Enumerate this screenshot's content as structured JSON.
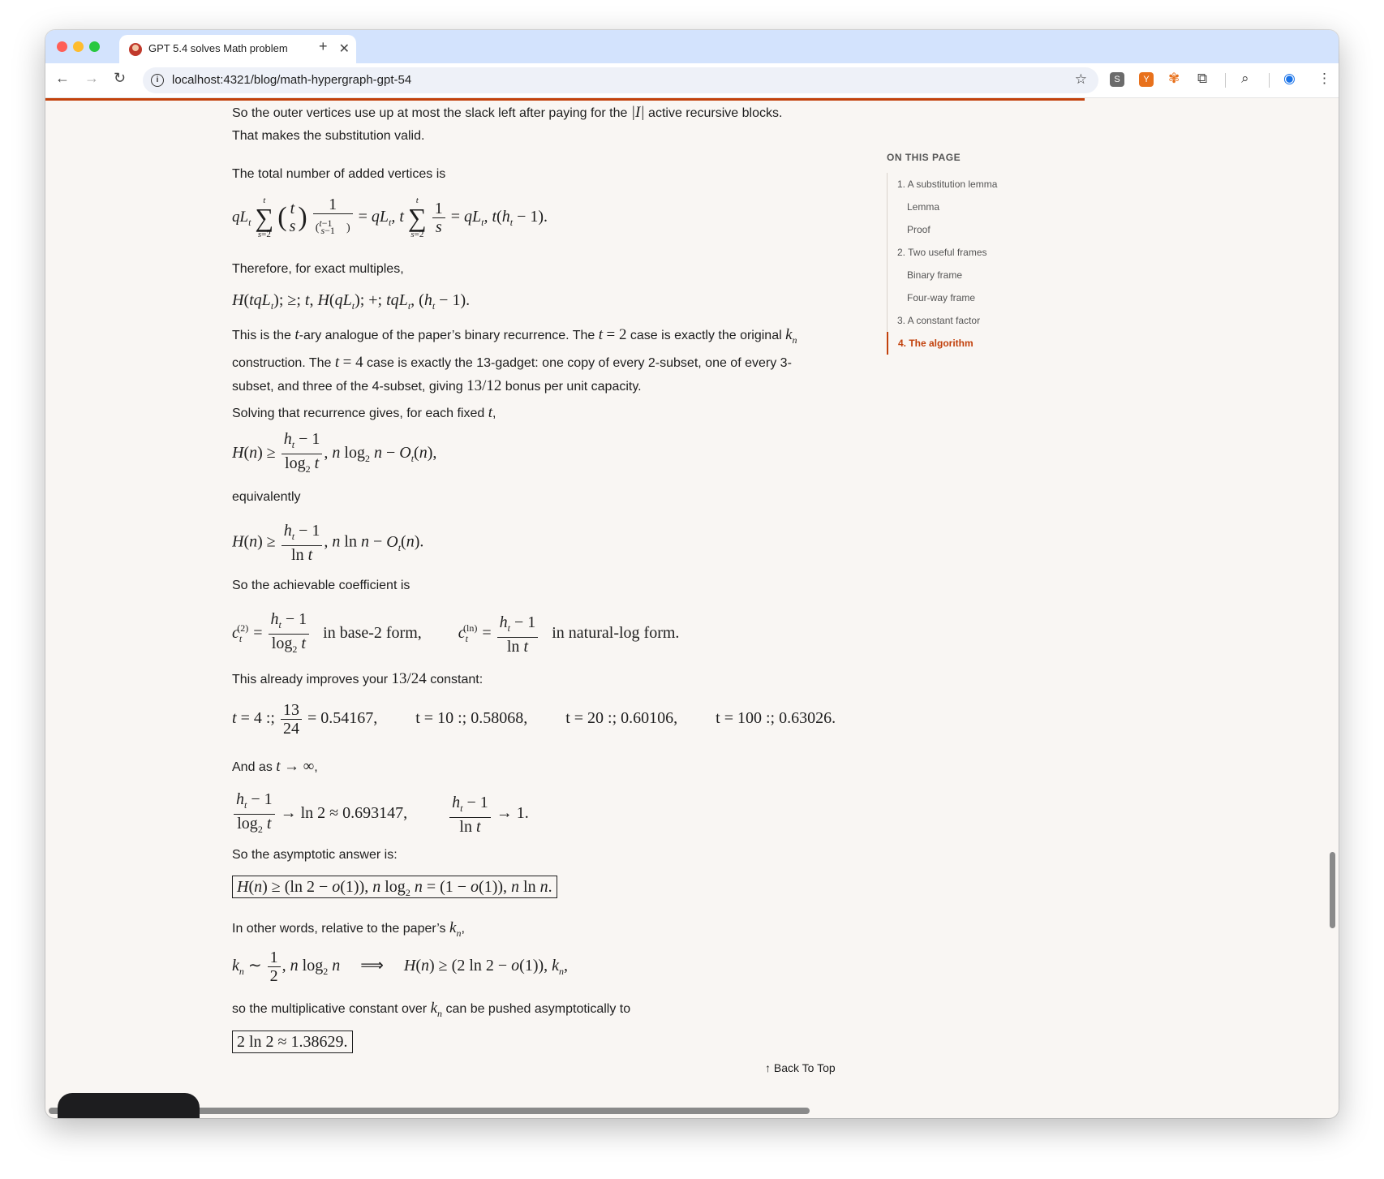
{
  "browser": {
    "tab_title": "GPT 5.4 solves Math problem",
    "tab_close": "✕",
    "new_tab": "+",
    "url": "localhost:4321/blog/math-hypergraph-gpt-54",
    "ext_s": "S",
    "ext_y": "Y"
  },
  "toc": {
    "heading": "ON THIS PAGE",
    "items": [
      {
        "label": "1. A substitution lemma"
      },
      {
        "label": "Lemma"
      },
      {
        "label": "Proof"
      },
      {
        "label": "2. Two useful frames"
      },
      {
        "label": "Binary frame"
      },
      {
        "label": "Four-way frame"
      },
      {
        "label": "3. A constant factor"
      },
      {
        "label": "4. The algorithm"
      }
    ]
  },
  "article": {
    "p1a": "So the outer vertices use up at most the slack left after paying for the ",
    "p1b": " active recursive blocks.",
    "p1c": "That makes the substitution valid.",
    "p2": "The total number of added vertices is",
    "p3": "Therefore, for exact multiples,",
    "p4a": "This is the ",
    "p4b": "-ary analogue of the paper’s binary recurrence. The ",
    "p4c": " case is exactly the original ",
    "p4d": "construction. The ",
    "p4e": " case is exactly the 13-gadget: one copy of every 2-subset, one of every 3-",
    "p4f": "subset, and three of the 4-subset, giving ",
    "p4g": " bonus per unit capacity.",
    "p5a": "Solving that recurrence gives, for each fixed ",
    "p5b": ",",
    "p6": "equivalently",
    "p7": "So the achievable coefficient is",
    "p8a": "This already improves your ",
    "p8b": " constant:",
    "p9a": "And as ",
    "p9b": ",",
    "p10": "So the asymptotic answer is:",
    "p11a": "In other words, relative to the paper’s ",
    "p11b": ",",
    "p12a": "so the multiplicative constant over ",
    "p12b": " can be pushed asymptotically to",
    "in_base2": "in base-2 form,",
    "in_natlog": "in natural-log form.",
    "v1": "= 0.54167,",
    "v2": "t = 10 :; 0.58068,",
    "v3": "t = 20 :; 0.60106,",
    "v4": "t = 100 :; 0.63026.",
    "lim1": "→ ln 2 ≈ 0.693147,",
    "lim2": "→ 1.",
    "final": "2 ln 2 ≈ 1.38629."
  },
  "back_to_top": "Back To Top"
}
